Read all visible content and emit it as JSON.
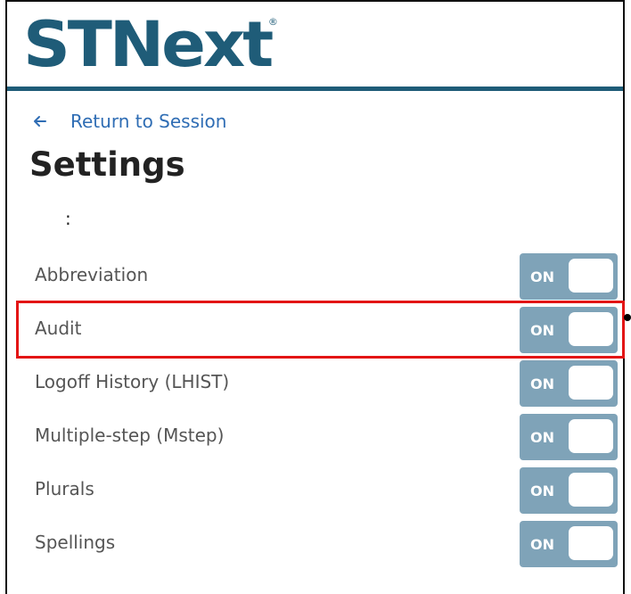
{
  "header": {
    "logo_text": "STNext",
    "logo_reg_mark": "®",
    "brand_color": "#1f5c78"
  },
  "nav": {
    "back_label": "Return to Session",
    "back_icon": "arrow-left-icon",
    "link_color": "#2f6db4"
  },
  "page": {
    "title": "Settings",
    "colon": ":"
  },
  "settings": {
    "items": [
      {
        "label": "Abbreviation",
        "state": "ON"
      },
      {
        "label": "Audit",
        "state": "ON"
      },
      {
        "label": "Logoff History (LHIST)",
        "state": "ON"
      },
      {
        "label": "Multiple-step (Mstep)",
        "state": "ON"
      },
      {
        "label": "Plurals",
        "state": "ON"
      },
      {
        "label": "Spellings",
        "state": "ON"
      }
    ],
    "toggle_color": "#7fa3b8",
    "highlight_color": "#e31515"
  }
}
